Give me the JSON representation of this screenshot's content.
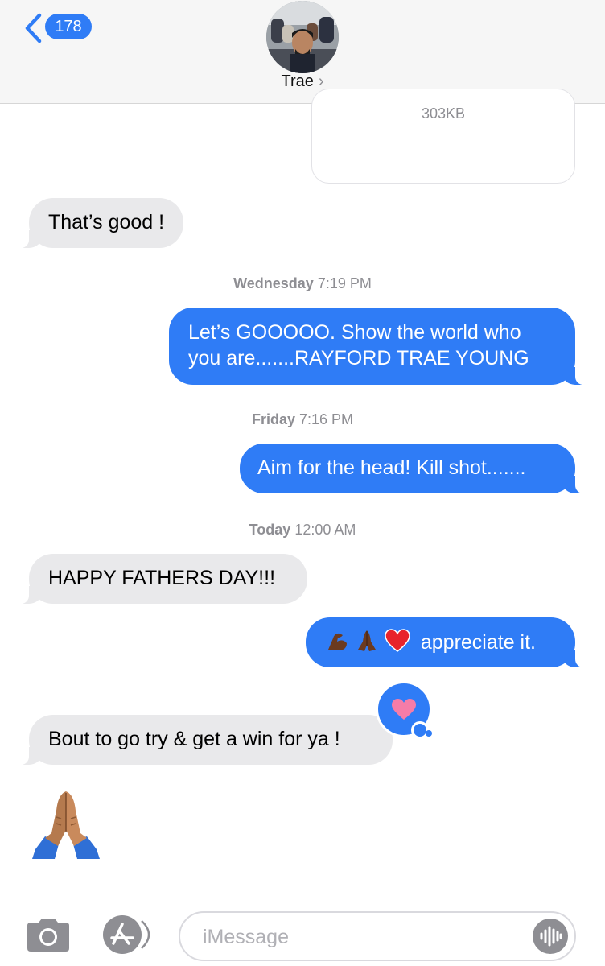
{
  "header": {
    "back_count": "178",
    "contact_name": "Trae",
    "contact_chevron": "›"
  },
  "attachment": {
    "size": "303KB"
  },
  "messages": [
    {
      "text": "That’s good !"
    },
    {
      "text_line1": "Let’s GOOOOO. Show the world who",
      "text_line2": "you are.......RAYFORD TRAE YOUNG"
    },
    {
      "text": "Aim for the head! Kill shot......."
    },
    {
      "text": "HAPPY FATHERS DAY!!!"
    },
    {
      "text": "appreciate it.",
      "emojis": [
        "flexed-biceps",
        "folded-hands",
        "red-heart"
      ]
    },
    {
      "text": "Bout to go try & get a win for ya !",
      "tapback": "heart"
    },
    {
      "emoji": "folded-hands"
    }
  ],
  "timestamps": [
    {
      "day": "Wednesday",
      "time": "7:19 PM"
    },
    {
      "day": "Friday",
      "time": "7:16 PM"
    },
    {
      "day": "Today",
      "time": "12:00 AM"
    }
  ],
  "input": {
    "placeholder": "iMessage"
  },
  "icons": {
    "back": "chevron-left-icon",
    "camera": "camera-icon",
    "apps": "app-store-icon",
    "audio": "audio-waveform-icon"
  },
  "colors": {
    "accent": "#2f7cf6",
    "incoming_bubble": "#e9e9eb",
    "header_bg": "#f6f6f6",
    "secondary_text": "#8e8e93"
  }
}
